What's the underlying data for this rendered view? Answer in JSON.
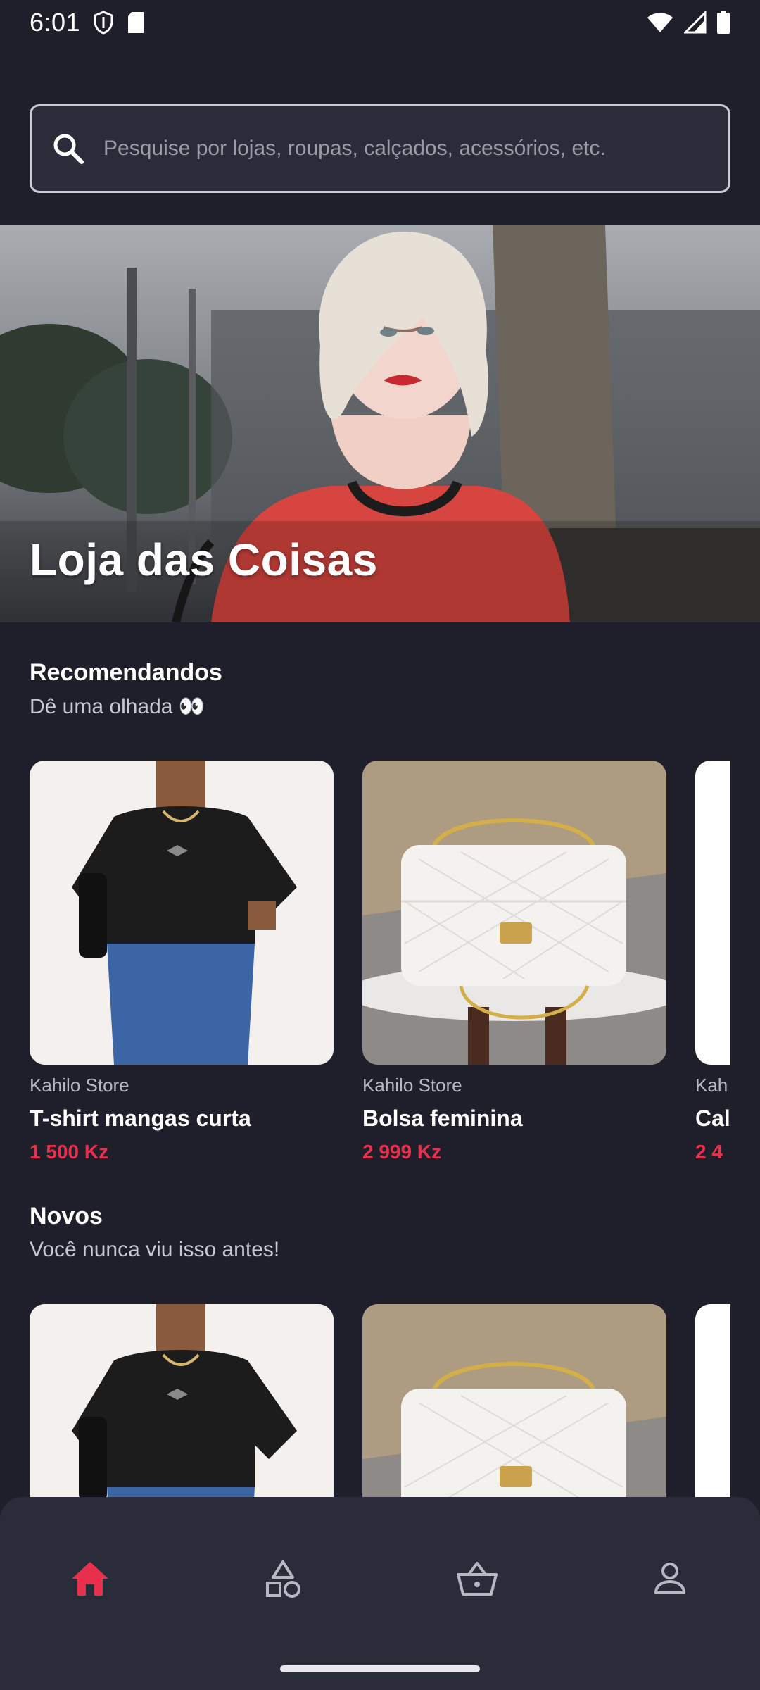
{
  "status_bar": {
    "time": "6:01"
  },
  "search": {
    "placeholder": "Pesquise por lojas, roupas, calçados, acessórios, etc."
  },
  "hero": {
    "title": "Loja das Coisas"
  },
  "recommended": {
    "title": "Recomendandos",
    "subtitle": "Dê uma olhada 👀",
    "items": [
      {
        "store": "Kahilo Store",
        "name": "T-shirt mangas curta",
        "price": "1 500 Kz"
      },
      {
        "store": "Kahilo Store",
        "name": "Bolsa feminina",
        "price": "2 999 Kz"
      },
      {
        "store": "Kah",
        "name": "Cal",
        "price": "2 4"
      }
    ]
  },
  "new": {
    "title": "Novos",
    "subtitle": "Você nunca viu isso antes!"
  },
  "nav": {
    "items": [
      {
        "icon": "home-icon",
        "active": true
      },
      {
        "icon": "categories-icon",
        "active": false
      },
      {
        "icon": "basket-icon",
        "active": false
      },
      {
        "icon": "profile-icon",
        "active": false
      }
    ]
  },
  "colors": {
    "background": "#1f1f2b",
    "accent": "#e6304c",
    "nav_bg": "#2a2c39"
  }
}
